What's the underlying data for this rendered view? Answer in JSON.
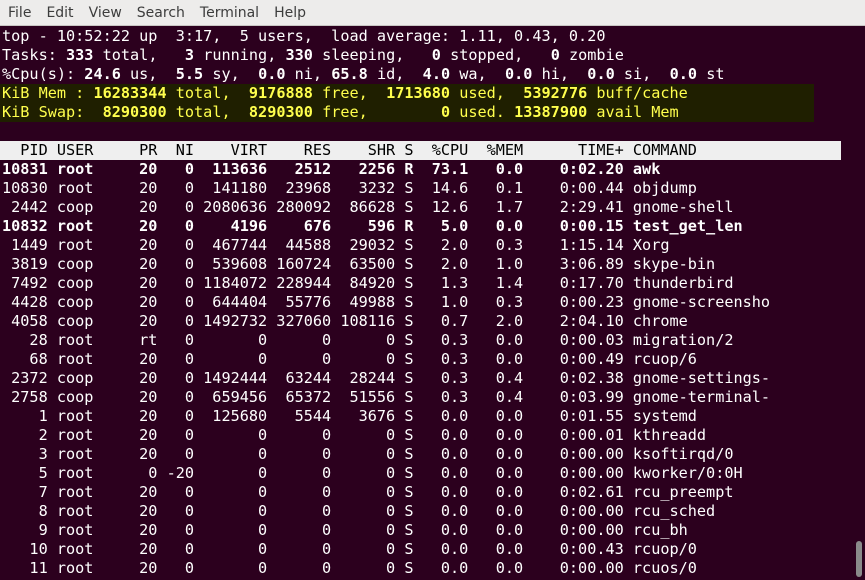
{
  "menu": [
    "File",
    "Edit",
    "View",
    "Search",
    "Terminal",
    "Help"
  ],
  "summary": {
    "line1": "top - 10:52:22 up  3:17,  5 users,  load average: 1.11, 0.43, 0.20",
    "tasks": {
      "total": "333",
      "running": "3",
      "sleeping": "330",
      "stopped": "0",
      "zombie": "0"
    },
    "cpu": {
      "us": "24.6",
      "sy": "5.5",
      "ni": "0.0",
      "id": "65.8",
      "wa": "4.0",
      "hi": "0.0",
      "si": "0.0",
      "st": "0.0"
    },
    "mem": {
      "total": "16283344",
      "free": "9176888",
      "used": "1713680",
      "buff_cache": "5392776"
    },
    "swap": {
      "total": "8290300",
      "free": "8290300",
      "used": "0",
      "avail": "13387900"
    }
  },
  "columns": [
    "PID",
    "USER",
    "PR",
    "NI",
    "VIRT",
    "RES",
    "SHR",
    "S",
    "%CPU",
    "%MEM",
    "TIME+",
    "COMMAND"
  ],
  "processes": [
    {
      "pid": "10831",
      "user": "root",
      "pr": "20",
      "ni": "0",
      "virt": "113636",
      "res": "2512",
      "shr": "2256",
      "s": "R",
      "cpu": "73.1",
      "mem": "0.0",
      "time": "0:02.20",
      "cmd": "awk",
      "bold": true
    },
    {
      "pid": "10830",
      "user": "root",
      "pr": "20",
      "ni": "0",
      "virt": "141180",
      "res": "23968",
      "shr": "3232",
      "s": "S",
      "cpu": "14.6",
      "mem": "0.1",
      "time": "0:00.44",
      "cmd": "objdump",
      "bold": false
    },
    {
      "pid": "2442",
      "user": "coop",
      "pr": "20",
      "ni": "0",
      "virt": "2080636",
      "res": "280092",
      "shr": "86628",
      "s": "S",
      "cpu": "12.6",
      "mem": "1.7",
      "time": "2:29.41",
      "cmd": "gnome-shell",
      "bold": false
    },
    {
      "pid": "10832",
      "user": "root",
      "pr": "20",
      "ni": "0",
      "virt": "4196",
      "res": "676",
      "shr": "596",
      "s": "R",
      "cpu": "5.0",
      "mem": "0.0",
      "time": "0:00.15",
      "cmd": "test_get_len",
      "bold": true
    },
    {
      "pid": "1449",
      "user": "root",
      "pr": "20",
      "ni": "0",
      "virt": "467744",
      "res": "44588",
      "shr": "29032",
      "s": "S",
      "cpu": "2.0",
      "mem": "0.3",
      "time": "1:15.14",
      "cmd": "Xorg",
      "bold": false
    },
    {
      "pid": "3819",
      "user": "coop",
      "pr": "20",
      "ni": "0",
      "virt": "539608",
      "res": "160724",
      "shr": "63500",
      "s": "S",
      "cpu": "2.0",
      "mem": "1.0",
      "time": "3:06.89",
      "cmd": "skype-bin",
      "bold": false
    },
    {
      "pid": "7492",
      "user": "coop",
      "pr": "20",
      "ni": "0",
      "virt": "1184072",
      "res": "228944",
      "shr": "84920",
      "s": "S",
      "cpu": "1.3",
      "mem": "1.4",
      "time": "0:17.70",
      "cmd": "thunderbird",
      "bold": false
    },
    {
      "pid": "4428",
      "user": "coop",
      "pr": "20",
      "ni": "0",
      "virt": "644404",
      "res": "55776",
      "shr": "49988",
      "s": "S",
      "cpu": "1.0",
      "mem": "0.3",
      "time": "0:00.23",
      "cmd": "gnome-screensho",
      "bold": false
    },
    {
      "pid": "4058",
      "user": "coop",
      "pr": "20",
      "ni": "0",
      "virt": "1492732",
      "res": "327060",
      "shr": "108116",
      "s": "S",
      "cpu": "0.7",
      "mem": "2.0",
      "time": "2:04.10",
      "cmd": "chrome",
      "bold": false
    },
    {
      "pid": "28",
      "user": "root",
      "pr": "rt",
      "ni": "0",
      "virt": "0",
      "res": "0",
      "shr": "0",
      "s": "S",
      "cpu": "0.3",
      "mem": "0.0",
      "time": "0:00.03",
      "cmd": "migration/2",
      "bold": false
    },
    {
      "pid": "68",
      "user": "root",
      "pr": "20",
      "ni": "0",
      "virt": "0",
      "res": "0",
      "shr": "0",
      "s": "S",
      "cpu": "0.3",
      "mem": "0.0",
      "time": "0:00.49",
      "cmd": "rcuop/6",
      "bold": false
    },
    {
      "pid": "2372",
      "user": "coop",
      "pr": "20",
      "ni": "0",
      "virt": "1492444",
      "res": "63244",
      "shr": "28244",
      "s": "S",
      "cpu": "0.3",
      "mem": "0.4",
      "time": "0:02.38",
      "cmd": "gnome-settings-",
      "bold": false
    },
    {
      "pid": "2758",
      "user": "coop",
      "pr": "20",
      "ni": "0",
      "virt": "659456",
      "res": "65372",
      "shr": "51556",
      "s": "S",
      "cpu": "0.3",
      "mem": "0.4",
      "time": "0:03.99",
      "cmd": "gnome-terminal-",
      "bold": false
    },
    {
      "pid": "1",
      "user": "root",
      "pr": "20",
      "ni": "0",
      "virt": "125680",
      "res": "5544",
      "shr": "3676",
      "s": "S",
      "cpu": "0.0",
      "mem": "0.0",
      "time": "0:01.55",
      "cmd": "systemd",
      "bold": false
    },
    {
      "pid": "2",
      "user": "root",
      "pr": "20",
      "ni": "0",
      "virt": "0",
      "res": "0",
      "shr": "0",
      "s": "S",
      "cpu": "0.0",
      "mem": "0.0",
      "time": "0:00.01",
      "cmd": "kthreadd",
      "bold": false
    },
    {
      "pid": "3",
      "user": "root",
      "pr": "20",
      "ni": "0",
      "virt": "0",
      "res": "0",
      "shr": "0",
      "s": "S",
      "cpu": "0.0",
      "mem": "0.0",
      "time": "0:00.00",
      "cmd": "ksoftirqd/0",
      "bold": false
    },
    {
      "pid": "5",
      "user": "root",
      "pr": "0",
      "ni": "-20",
      "virt": "0",
      "res": "0",
      "shr": "0",
      "s": "S",
      "cpu": "0.0",
      "mem": "0.0",
      "time": "0:00.00",
      "cmd": "kworker/0:0H",
      "bold": false
    },
    {
      "pid": "7",
      "user": "root",
      "pr": "20",
      "ni": "0",
      "virt": "0",
      "res": "0",
      "shr": "0",
      "s": "S",
      "cpu": "0.0",
      "mem": "0.0",
      "time": "0:02.61",
      "cmd": "rcu_preempt",
      "bold": false
    },
    {
      "pid": "8",
      "user": "root",
      "pr": "20",
      "ni": "0",
      "virt": "0",
      "res": "0",
      "shr": "0",
      "s": "S",
      "cpu": "0.0",
      "mem": "0.0",
      "time": "0:00.00",
      "cmd": "rcu_sched",
      "bold": false
    },
    {
      "pid": "9",
      "user": "root",
      "pr": "20",
      "ni": "0",
      "virt": "0",
      "res": "0",
      "shr": "0",
      "s": "S",
      "cpu": "0.0",
      "mem": "0.0",
      "time": "0:00.00",
      "cmd": "rcu_bh",
      "bold": false
    },
    {
      "pid": "10",
      "user": "root",
      "pr": "20",
      "ni": "0",
      "virt": "0",
      "res": "0",
      "shr": "0",
      "s": "S",
      "cpu": "0.0",
      "mem": "0.0",
      "time": "0:00.43",
      "cmd": "rcuop/0",
      "bold": false
    },
    {
      "pid": "11",
      "user": "root",
      "pr": "20",
      "ni": "0",
      "virt": "0",
      "res": "0",
      "shr": "0",
      "s": "S",
      "cpu": "0.0",
      "mem": "0.0",
      "time": "0:00.00",
      "cmd": "rcuos/0",
      "bold": false
    }
  ]
}
